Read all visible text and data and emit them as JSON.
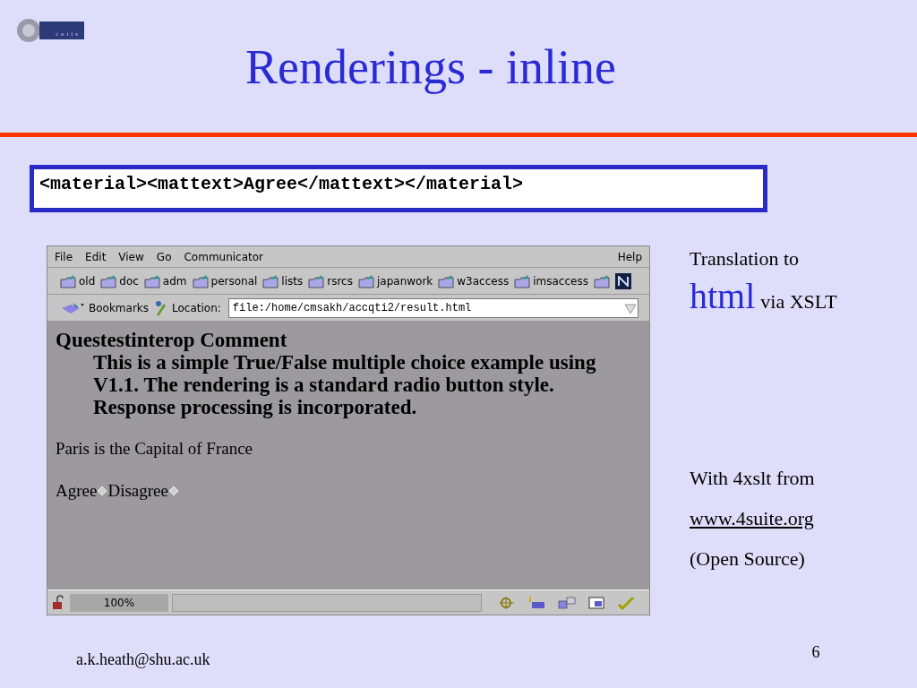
{
  "logo": {
    "text": "cetis"
  },
  "title": "Renderings - inline",
  "code": "<material><mattext>Agree</mattext></material>",
  "browser": {
    "menu": [
      "File",
      "Edit",
      "View",
      "Go",
      "Communicator"
    ],
    "help": "Help",
    "bookmarks": [
      "old",
      "doc",
      "adm",
      "personal",
      "lists",
      "rsrcs",
      "japanwork",
      "w3access",
      "imsaccess"
    ],
    "bookmarks_label": "Bookmarks",
    "location_label": "Location:",
    "location": "file:/home/cmsakh/accqti2/result.html",
    "heading": "Questestinterop Comment",
    "comment": "This is a simple True/False multiple choice example using V1.1. The rendering is a standard radio button style. Response processing is incorporated.",
    "question": "Paris is the Capital of France",
    "options": [
      {
        "label": "Agree",
        "selected": false
      },
      {
        "label": "Disagree",
        "selected": false
      }
    ],
    "status": {
      "zoom": "100%"
    }
  },
  "side": {
    "line1": "Translation to",
    "big": "html",
    "small": "via XSLT",
    "line2": "With 4xslt from",
    "link": "www.4suite.org",
    "line3": "(Open Source)"
  },
  "footer": {
    "email": "a.k.heath@shu.ac.uk",
    "page": "6"
  }
}
